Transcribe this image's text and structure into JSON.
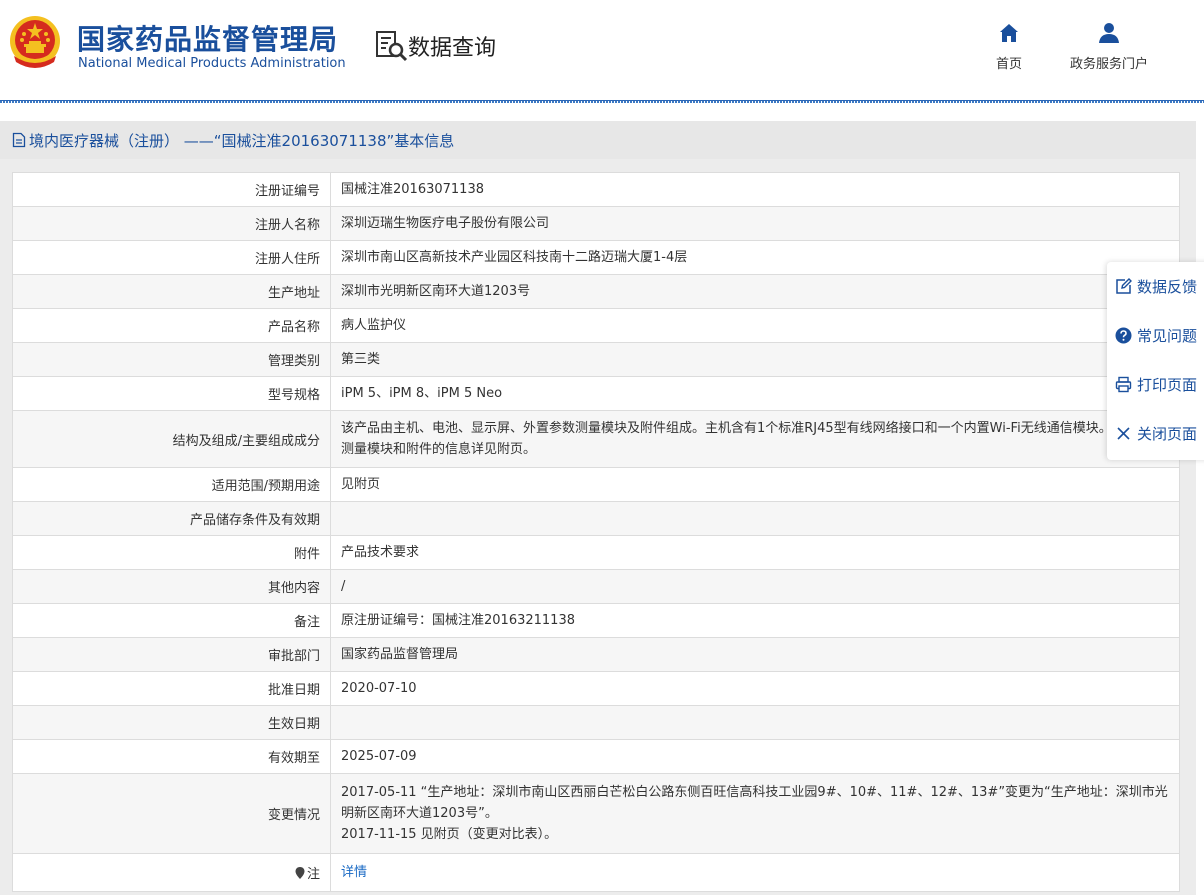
{
  "header": {
    "agency_cn": "国家药品监督管理局",
    "agency_en": "National Medical Products Administration",
    "query_title": "数据查询",
    "nav": [
      {
        "label": "首页",
        "icon": "home-icon"
      },
      {
        "label": "政务服务门户",
        "icon": "user-icon"
      }
    ]
  },
  "panel": {
    "title": "境内医疗器械（注册） ——“国械注准20163071138”基本信息"
  },
  "rows": [
    {
      "label": "注册证编号",
      "value": "国械注准20163071138"
    },
    {
      "label": "注册人名称",
      "value": "深圳迈瑞生物医疗电子股份有限公司"
    },
    {
      "label": "注册人住所",
      "value": "深圳市南山区高新技术产业园区科技南十二路迈瑞大厦1-4层"
    },
    {
      "label": "生产地址",
      "value": "深圳市光明新区南环大道1203号"
    },
    {
      "label": "产品名称",
      "value": "病人监护仪"
    },
    {
      "label": "管理类别",
      "value": "第三类"
    },
    {
      "label": "型号规格",
      "value": "iPM 5、iPM 8、iPM 5 Neo"
    },
    {
      "label": "结构及组成/主要组成成分",
      "value": "该产品由主机、电池、显示屏、外置参数测量模块及附件组成。主机含有1个标准RJ45型有线网络接口和一个内置Wi-Fi无线通信模块。外置参数测量模块和附件的信息详见附页。"
    },
    {
      "label": "适用范围/预期用途",
      "value": "见附页"
    },
    {
      "label": "产品储存条件及有效期",
      "value": ""
    },
    {
      "label": "附件",
      "value": "产品技术要求"
    },
    {
      "label": "其他内容",
      "value": "/"
    },
    {
      "label": "备注",
      "value": "原注册证编号：国械注准20163211138"
    },
    {
      "label": "审批部门",
      "value": "国家药品监督管理局"
    },
    {
      "label": "批准日期",
      "value": "2020-07-10"
    },
    {
      "label": "生效日期",
      "value": ""
    },
    {
      "label": "有效期至",
      "value": "2025-07-09"
    },
    {
      "label": "变更情况",
      "value_lines": [
        "2017-05-11 “生产地址：深圳市南山区西丽白芒松白公路东侧百旺信高科技工业园9#、10#、11#、12#、13#”变更为“生产地址：深圳市光明新区南环大道1203号”。",
        "2017-11-15 见附页（变更对比表）。"
      ]
    },
    {
      "label": "注",
      "value": "详情",
      "value_is_link": true
    }
  ],
  "side_tools": [
    {
      "label": "数据反馈",
      "icon": "edit-icon"
    },
    {
      "label": "常见问题",
      "icon": "question-icon"
    },
    {
      "label": "打印页面",
      "icon": "print-icon"
    },
    {
      "label": "关闭页面",
      "icon": "close-icon"
    }
  ],
  "colors": {
    "brand_blue": "#1a4f9c",
    "link_blue": "#1a6ac4",
    "panel_gray": "#ececec",
    "emblem_red": "#d52b1e",
    "emblem_gold": "#f4c020"
  }
}
